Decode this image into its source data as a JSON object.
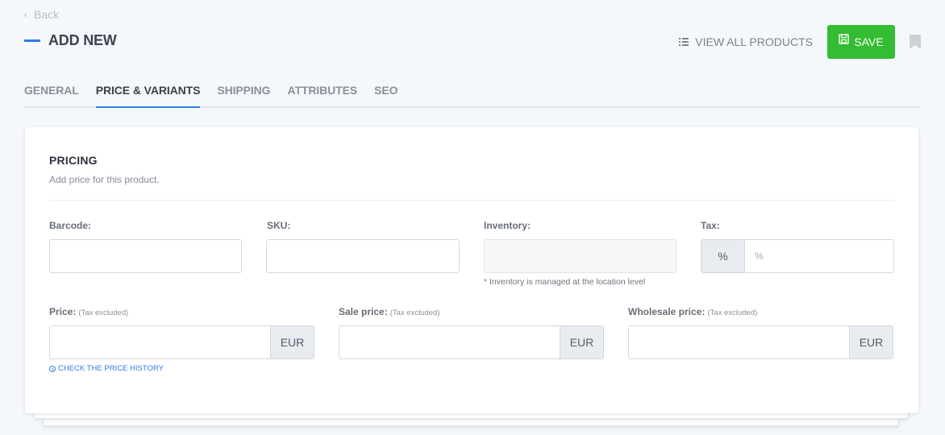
{
  "nav": {
    "back_label": "Back",
    "page_title": "ADD NEW"
  },
  "actions": {
    "view_all_label": "VIEW ALL PRODUCTS",
    "save_label": "SAVE"
  },
  "tabs": [
    {
      "label": "GENERAL",
      "active": false
    },
    {
      "label": "PRICE & VARIANTS",
      "active": true
    },
    {
      "label": "SHIPPING",
      "active": false
    },
    {
      "label": "ATTRIBUTES",
      "active": false
    },
    {
      "label": "SEO",
      "active": false
    }
  ],
  "pricing": {
    "title": "PRICING",
    "subtitle": "Add price for this product.",
    "barcode": {
      "label": "Barcode:",
      "value": ""
    },
    "sku": {
      "label": "SKU:",
      "value": ""
    },
    "inventory": {
      "label": "Inventory:",
      "value": "",
      "helper": "* Inventory is managed at the location level"
    },
    "tax": {
      "label": "Tax:",
      "addon": "%",
      "placeholder": "%",
      "value": ""
    },
    "price": {
      "label": "Price:",
      "note": "(Tax excluded)",
      "currency": "EUR",
      "value": "",
      "history_link": "CHECK THE PRICE HISTORY"
    },
    "sale_price": {
      "label": "Sale price:",
      "note": "(Tax excluded)",
      "currency": "EUR",
      "value": ""
    },
    "wholesale_price": {
      "label": "Wholesale price:",
      "note": "(Tax excluded)",
      "currency": "EUR",
      "value": ""
    }
  },
  "colors": {
    "accent": "#2f7be5",
    "save_green": "#34bc32",
    "background": "#f5f8fb"
  }
}
